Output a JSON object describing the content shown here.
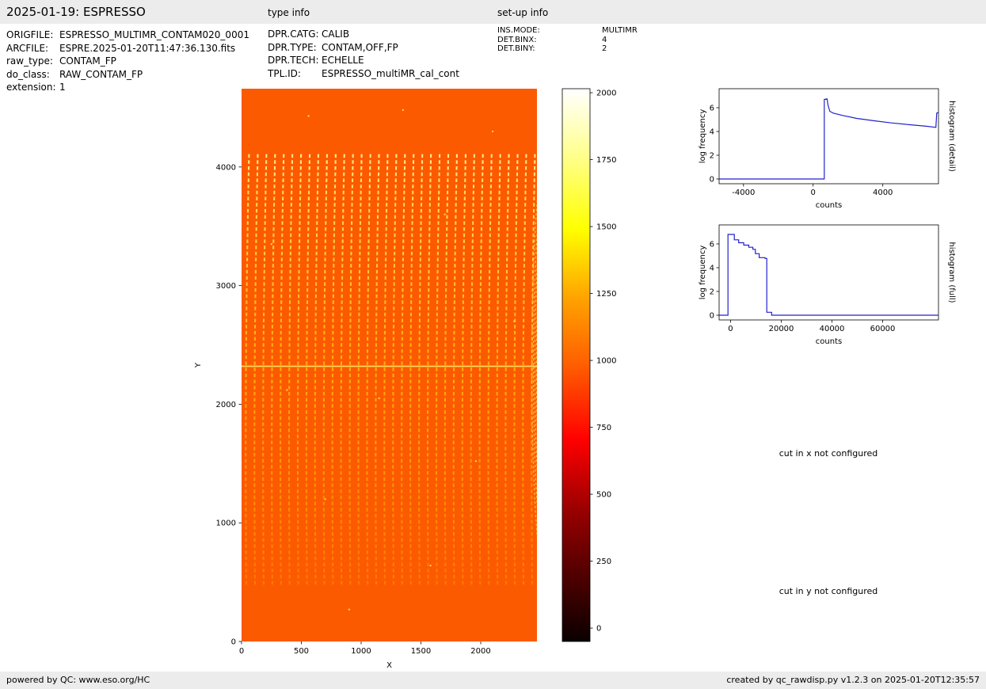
{
  "header": {
    "title": "2025-01-19: ESPRESSO",
    "type_info_label": "type info",
    "setup_info_label": "set-up info"
  },
  "metadata": {
    "file_info": [
      {
        "label": "ORIGFILE:",
        "value": "ESPRESSO_MULTIMR_CONTAM020_0001"
      },
      {
        "label": "ARCFILE:",
        "value": "ESPRE.2025-01-20T11:47:36.130.fits"
      },
      {
        "label": "raw_type:",
        "value": "CONTAM_FP"
      },
      {
        "label": "do_class:",
        "value": "RAW_CONTAM_FP"
      },
      {
        "label": "extension:",
        "value": "1"
      }
    ],
    "type_info": [
      {
        "label": "DPR.CATG:",
        "value": "CALIB"
      },
      {
        "label": "DPR.TYPE:",
        "value": "CONTAM,OFF,FP"
      },
      {
        "label": "DPR.TECH:",
        "value": "ECHELLE"
      },
      {
        "label": "TPL.ID:",
        "value": "ESPRESSO_multiMR_cal_cont"
      }
    ],
    "setup_info": [
      {
        "label": "INS.MODE:",
        "value": "MULTIMR"
      },
      {
        "label": "DET.BINX:",
        "value": "4"
      },
      {
        "label": "DET.BINY:",
        "value": "2"
      }
    ]
  },
  "annotations": {
    "cut_x": "cut in x not configured",
    "cut_y": "cut in y not configured"
  },
  "footer": {
    "left": "powered by QC: www.eso.org/HC",
    "right": "created by qc_rawdisp.py v1.2.3 on 2025-01-20T12:35:57"
  },
  "chart_data": [
    {
      "id": "raw_image",
      "type": "heatmap",
      "xlabel": "X",
      "ylabel": "Y",
      "xlim": [
        0,
        2470
      ],
      "ylim": [
        0,
        4660
      ],
      "xticks": [
        0,
        500,
        1000,
        1500,
        2000
      ],
      "yticks": [
        0,
        1000,
        2000,
        3000,
        4000
      ],
      "colormap": "hot",
      "colorbar": {
        "vmin": -50,
        "vmax": 2015,
        "ticks": [
          0,
          250,
          500,
          750,
          1000,
          1250,
          1500,
          1750,
          2000
        ]
      },
      "background_level": 1000,
      "colors": {
        "background": "#fc5a00",
        "stripe_top": "#fff0a0",
        "stripe_mid": "#ffb412",
        "stripe_bottom": "#ff7a00",
        "bright_row": "#ffe066",
        "arc": "#ffc44d"
      },
      "features": {
        "description": "Raw Fabry-Perot contamination frame: dashed bright echelle-order stripes, one bright horizontal row, nested interference arcs near right edge, few hot-pixel speckles",
        "stripe_count": 34,
        "stripe_x_range": [
          40,
          2430
        ],
        "stripe_y_range": [
          480,
          4120
        ],
        "bright_row_y": 2320,
        "arcs": {
          "count": 10,
          "cx": 2560,
          "cy": 2300,
          "rx0": 16,
          "drx": 13,
          "ry0": 170,
          "dry": 190
        },
        "speckles": [
          [
            560,
            4430
          ],
          [
            380,
            2120
          ],
          [
            1580,
            640
          ],
          [
            2100,
            4300
          ],
          [
            900,
            270
          ],
          [
            1350,
            4480
          ],
          [
            250,
            3350
          ],
          [
            1960,
            1520
          ],
          [
            700,
            1200
          ],
          [
            2280,
            2700
          ],
          [
            1150,
            2050
          ],
          [
            1700,
            3600
          ]
        ]
      }
    },
    {
      "id": "histogram_detail",
      "type": "line",
      "right_label": "histogram (detail)",
      "xlabel": "counts",
      "ylabel": "log frequency",
      "xlim": [
        -5400,
        7200
      ],
      "ylim": [
        -0.4,
        7.6
      ],
      "xticks": [
        -4000,
        0,
        4000
      ],
      "yticks": [
        0,
        2,
        4,
        6
      ],
      "line_color": "#2222cc",
      "points": [
        [
          -5400,
          0
        ],
        [
          640,
          0
        ],
        [
          640,
          6.7
        ],
        [
          800,
          6.75
        ],
        [
          860,
          6.2
        ],
        [
          960,
          5.7
        ],
        [
          1150,
          5.55
        ],
        [
          1700,
          5.35
        ],
        [
          2500,
          5.1
        ],
        [
          3500,
          4.9
        ],
        [
          4500,
          4.72
        ],
        [
          5500,
          4.57
        ],
        [
          6500,
          4.44
        ],
        [
          7050,
          4.35
        ],
        [
          7100,
          5.55
        ],
        [
          7200,
          5.6
        ]
      ]
    },
    {
      "id": "histogram_full",
      "type": "line",
      "right_label": "histogram (full)",
      "xlabel": "counts",
      "ylabel": "log frequency",
      "xlim": [
        -4500,
        82000
      ],
      "ylim": [
        -0.4,
        7.6
      ],
      "xticks": [
        0,
        20000,
        40000,
        60000
      ],
      "yticks": [
        0,
        2,
        4,
        6
      ],
      "line_color": "#2222cc",
      "points": [
        [
          -4500,
          0
        ],
        [
          -1000,
          0
        ],
        [
          -1000,
          6.8
        ],
        [
          1500,
          6.8
        ],
        [
          1500,
          6.35
        ],
        [
          3200,
          6.35
        ],
        [
          3200,
          6.1
        ],
        [
          5200,
          6.1
        ],
        [
          5200,
          5.9
        ],
        [
          7200,
          5.9
        ],
        [
          7200,
          5.72
        ],
        [
          8800,
          5.72
        ],
        [
          8800,
          5.55
        ],
        [
          9800,
          5.55
        ],
        [
          9800,
          5.18
        ],
        [
          11300,
          5.18
        ],
        [
          11300,
          4.85
        ],
        [
          13600,
          4.85
        ],
        [
          13600,
          4.78
        ],
        [
          14300,
          4.78
        ],
        [
          14300,
          0.25
        ],
        [
          16200,
          0.25
        ],
        [
          16200,
          0
        ],
        [
          82000,
          0
        ]
      ]
    }
  ]
}
